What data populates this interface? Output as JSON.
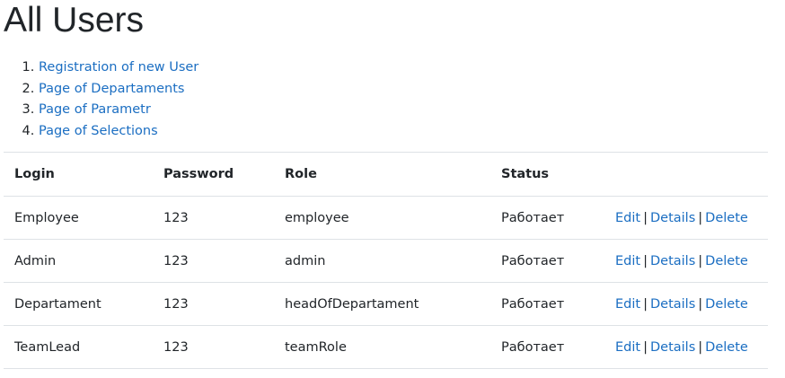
{
  "page": {
    "title": "All Users"
  },
  "nav_links": [
    {
      "label": "Registration of new User"
    },
    {
      "label": "Page of Departaments"
    },
    {
      "label": "Page of Parametr"
    },
    {
      "label": "Page of Selections"
    }
  ],
  "table": {
    "headers": {
      "login": "Login",
      "password": "Password",
      "role": "Role",
      "status": "Status"
    },
    "rows": [
      {
        "login": "Employee",
        "password": "123",
        "role": "employee",
        "status": "Работает"
      },
      {
        "login": "Admin",
        "password": "123",
        "role": "admin",
        "status": "Работает"
      },
      {
        "login": "Departament",
        "password": "123",
        "role": "headOfDepartament",
        "status": "Работает"
      },
      {
        "login": "TeamLead",
        "password": "123",
        "role": "teamRole",
        "status": "Работает"
      }
    ],
    "actions": {
      "edit": "Edit",
      "details": "Details",
      "delete": "Delete",
      "separator": "|"
    }
  },
  "colors": {
    "link": "#1b6ec2",
    "text": "#212529",
    "border": "#dee2e6"
  }
}
